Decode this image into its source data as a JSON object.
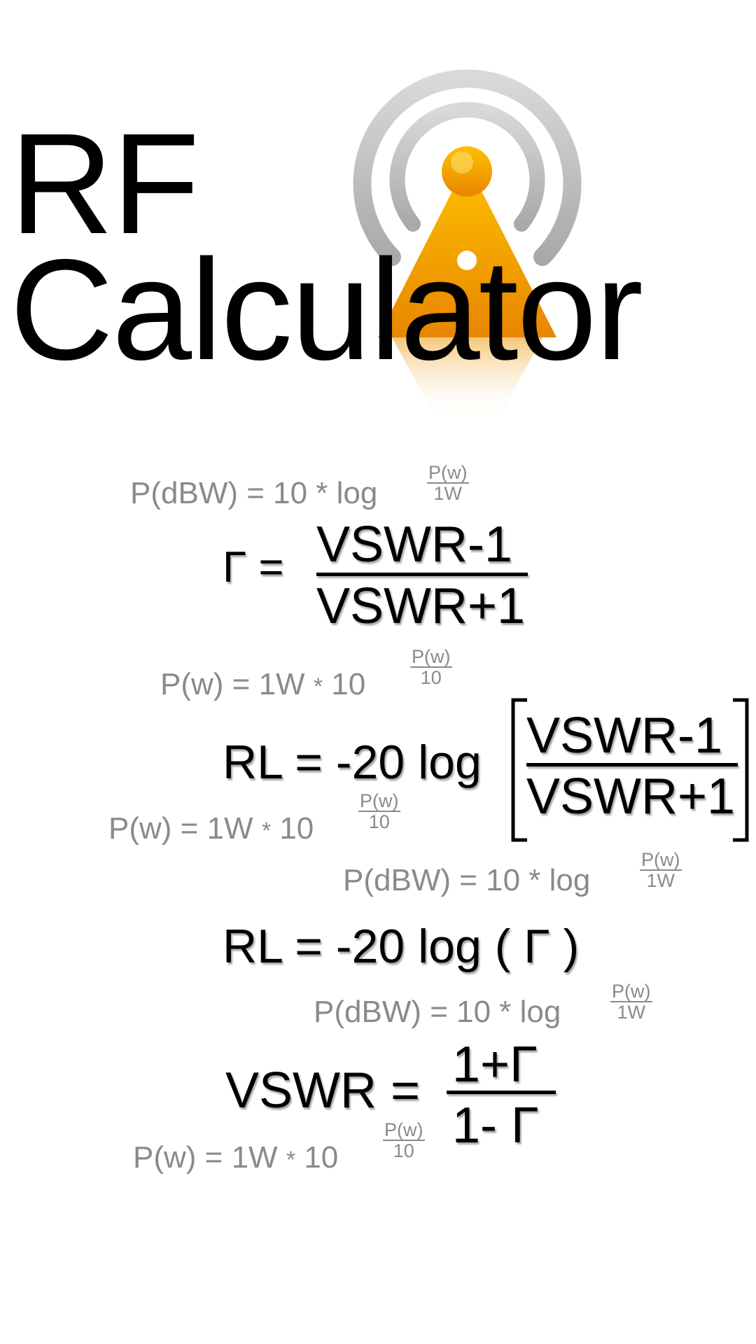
{
  "app": {
    "title_line1": "RF",
    "title_line2": "Calculator"
  },
  "logo": {
    "icon": "antenna-broadcast-icon",
    "colors": {
      "orange": "#f5a300",
      "grey": "#bcbcbc"
    }
  },
  "formulas": {
    "pdbw_1": {
      "left": "P(dBW) = 10 * log",
      "num": "P(w)",
      "den": "1W"
    },
    "gamma_def": {
      "lhs": "Γ =",
      "num": "VSWR-1",
      "den": "VSWR+1"
    },
    "pw_1": {
      "left": "P(w) = 1W",
      "star": "*",
      "base": "10",
      "num": "P(w)",
      "den": "10"
    },
    "rl_vswr": {
      "lhs": "RL = -20 log",
      "num": "VSWR-1",
      "den": "VSWR+1"
    },
    "pw_2": {
      "left": "P(w) = 1W",
      "star": "*",
      "base": "10",
      "num": "P(w)",
      "den": "10"
    },
    "pdbw_2": {
      "left": "P(dBW) = 10 * log",
      "num": "P(w)",
      "den": "1W"
    },
    "rl_gamma": {
      "text": "RL = -20 log ( Γ )"
    },
    "pdbw_3": {
      "left": "P(dBW) = 10 * log",
      "num": "P(w)",
      "den": "1W"
    },
    "vswr_def": {
      "lhs": "VSWR =",
      "num": "1+Γ",
      "den": "1- Γ"
    },
    "pw_3": {
      "left": "P(w) = 1W",
      "star": "*",
      "base": "10",
      "num": "P(w)",
      "den": "10"
    }
  }
}
